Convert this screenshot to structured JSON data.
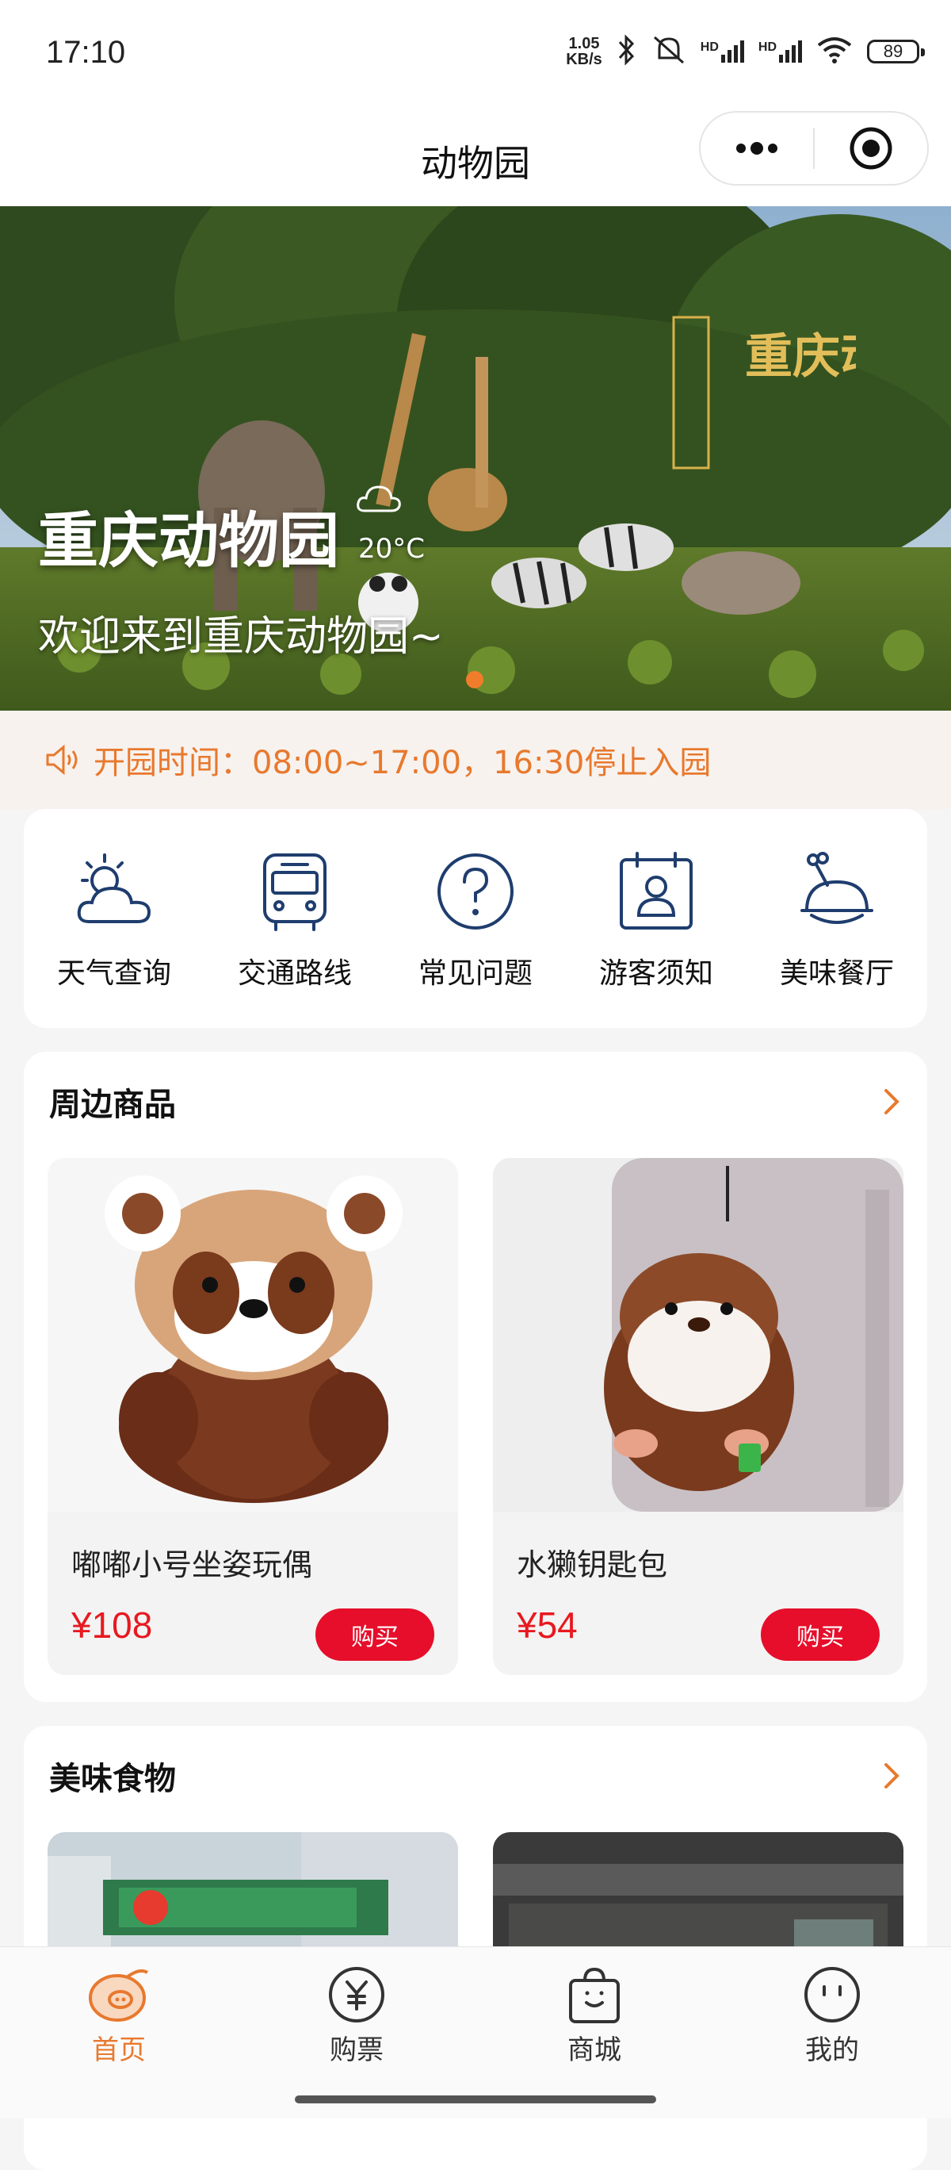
{
  "status_bar": {
    "time": "17:10",
    "net_speed_value": "1.05",
    "net_speed_unit": "KB/s",
    "signal_1": "HD",
    "signal_2": "HD",
    "battery": "89"
  },
  "nav": {
    "title": "动物园"
  },
  "banner": {
    "title": "重庆动物园",
    "temperature": "20°C",
    "subtitle": "欢迎来到重庆动物园~",
    "logo_text": "重庆动物园",
    "active_slide": 1
  },
  "notice": {
    "text": "开园时间：08:00~17:00，16:30停止入园"
  },
  "quick_links": [
    {
      "label": "天气查询",
      "icon": "weather-icon"
    },
    {
      "label": "交通路线",
      "icon": "bus-icon"
    },
    {
      "label": "常见问题",
      "icon": "question-icon"
    },
    {
      "label": "游客须知",
      "icon": "visitor-notice-icon"
    },
    {
      "label": "美味餐厅",
      "icon": "restaurant-icon"
    }
  ],
  "goods": {
    "title": "周边商品",
    "items": [
      {
        "name": "嘟嘟小号坐姿玩偶",
        "price": "¥108",
        "buy_label": "购买",
        "image": "red-panda-plush"
      },
      {
        "name": "水獭钥匙包",
        "price": "¥54",
        "buy_label": "购买",
        "image": "otter-keychain"
      }
    ]
  },
  "food": {
    "title": "美味食物",
    "items": [
      {
        "image": "restaurant-storefront"
      },
      {
        "image": "restaurant-interior"
      }
    ]
  },
  "tabs": [
    {
      "label": "首页",
      "icon": "home-icon",
      "active": true
    },
    {
      "label": "购票",
      "icon": "ticket-yen-icon",
      "active": false
    },
    {
      "label": "商城",
      "icon": "shopping-bag-icon",
      "active": false
    },
    {
      "label": "我的",
      "icon": "profile-icon",
      "active": false
    }
  ],
  "colors": {
    "accent": "#e8792e",
    "price": "#e8191f",
    "buy_button": "#e60e2a",
    "icon_blue": "#1f3d6e"
  }
}
